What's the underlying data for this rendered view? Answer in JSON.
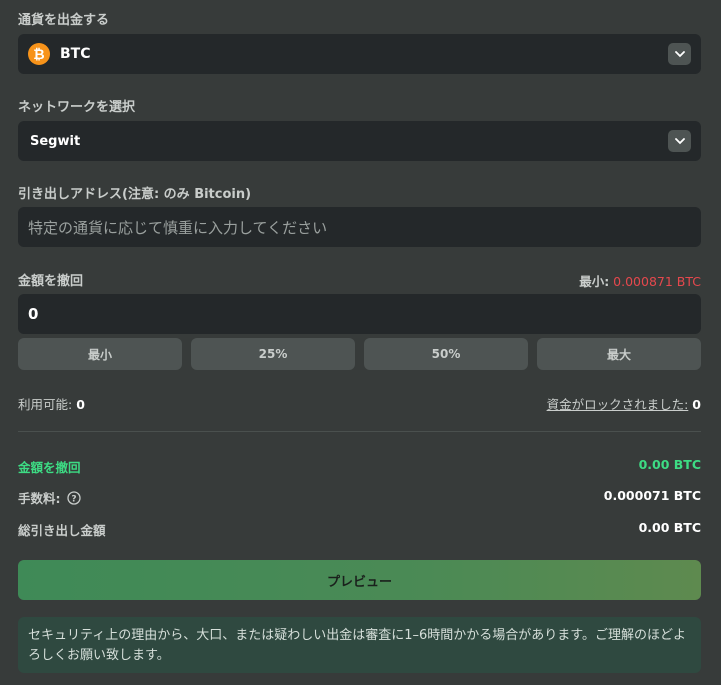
{
  "currency_section": {
    "label": "通貨を出金する",
    "selected": "BTC",
    "coin_symbol": "₿"
  },
  "network_section": {
    "label": "ネットワークを選択",
    "selected": "Segwit"
  },
  "address_section": {
    "label": "引き出しアドレス(注意: のみ Bitcoin)",
    "placeholder": "特定の通貨に応じて慎重に入力してください"
  },
  "amount_section": {
    "label": "金額を撤回",
    "min_label": "最小:",
    "min_value": "0.000871 BTC",
    "value": "0",
    "quick_buttons": [
      "最小",
      "25%",
      "50%",
      "最大"
    ]
  },
  "balances": {
    "available_label": "利用可能:",
    "available_value": "0",
    "locked_label": "資金がロックされました:",
    "locked_value": "0"
  },
  "summary": {
    "withdraw_label": "金額を撤回",
    "withdraw_value": "0.00 BTC",
    "fee_label": "手数料:",
    "fee_value": "0.000071 BTC",
    "total_label": "総引き出し金額",
    "total_value": "0.00 BTC"
  },
  "preview_button": "プレビュー",
  "notice": "セキュリティ上の理由から、大口、または疑わしい出金は審査に1–6時間かかる場合があります。ご理解のほどよろしくお願い致します。",
  "colors": {
    "background": "#373b3a",
    "field": "#24282a",
    "accent_green": "#3ddc84",
    "min_red": "#e5484d",
    "bitcoin": "#f7931a"
  }
}
